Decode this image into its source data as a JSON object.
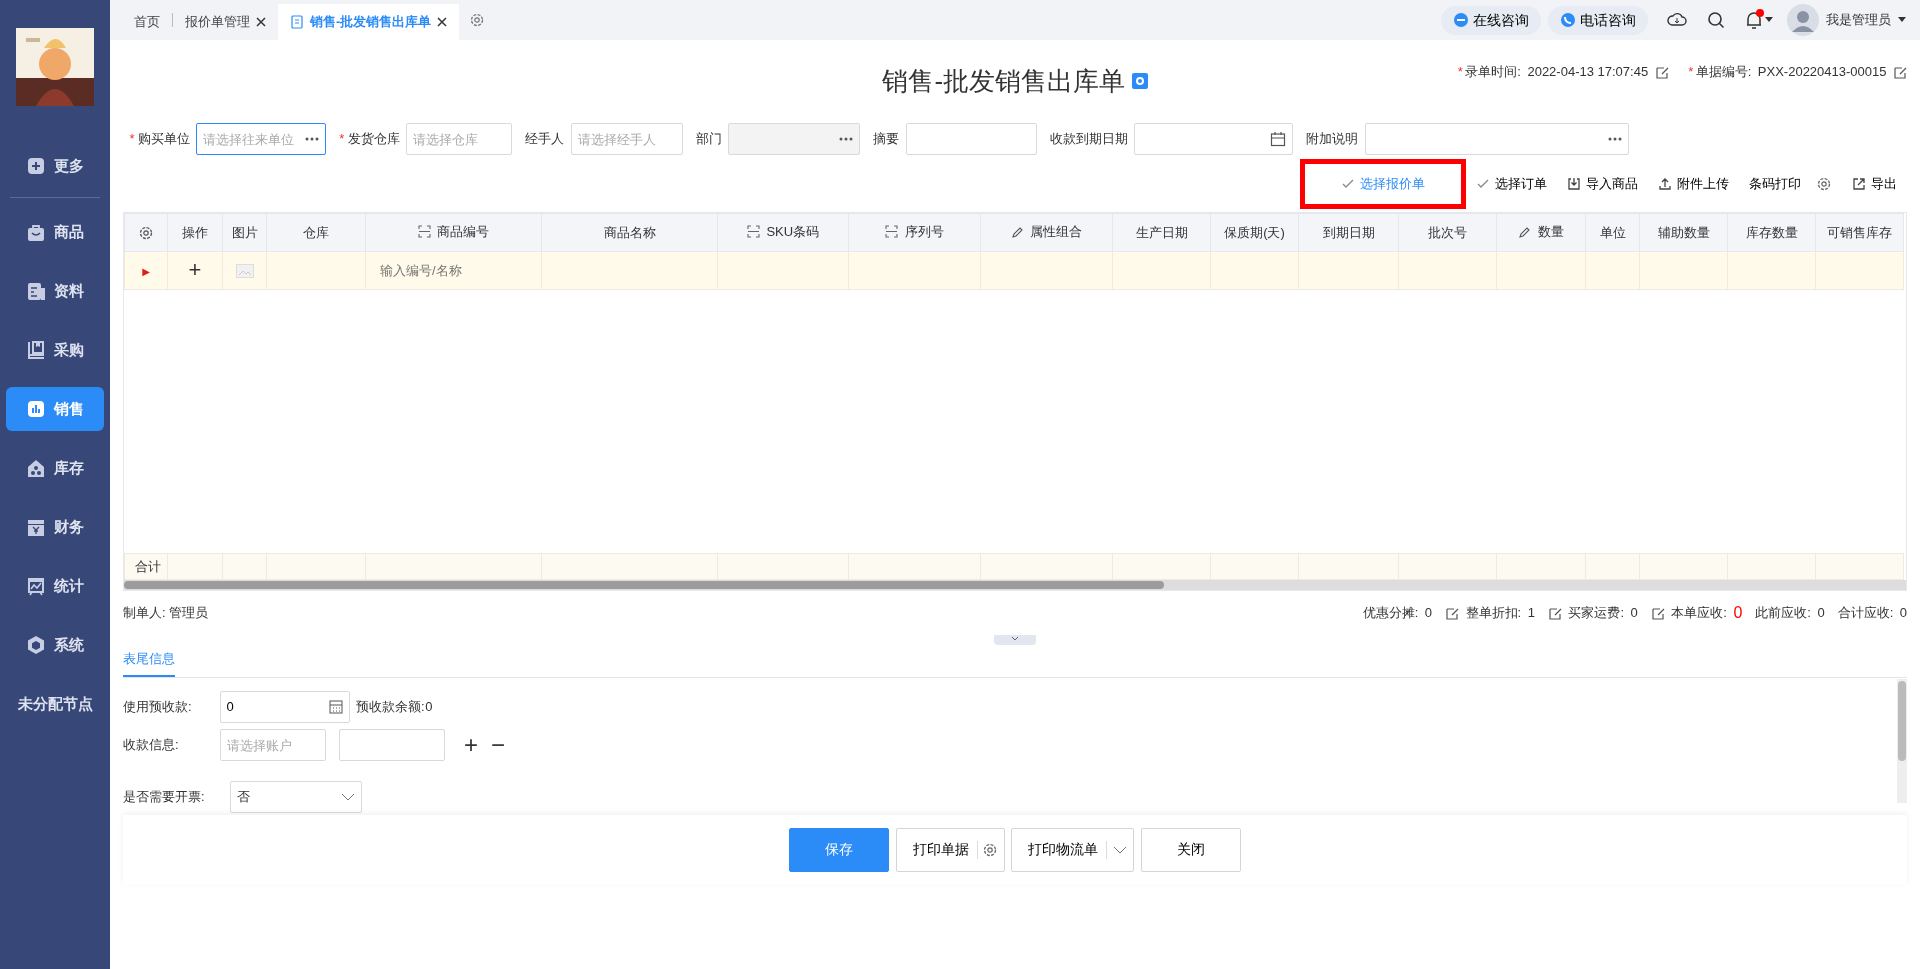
{
  "sidebar": {
    "items": [
      {
        "label": "更多",
        "selected": false
      },
      {
        "label": "商品",
        "selected": false
      },
      {
        "label": "资料",
        "selected": false
      },
      {
        "label": "采购",
        "selected": false
      },
      {
        "label": "销售",
        "selected": true
      },
      {
        "label": "库存",
        "selected": false
      },
      {
        "label": "财务",
        "selected": false
      },
      {
        "label": "统计",
        "selected": false
      },
      {
        "label": "系统",
        "selected": false
      },
      {
        "label": "未分配节点",
        "selected": false
      }
    ]
  },
  "tabs": [
    {
      "label": "首页",
      "selected": false,
      "closable": false
    },
    {
      "label": "报价单管理",
      "selected": false,
      "closable": true
    },
    {
      "label": "销售-批发销售出库单",
      "selected": true,
      "closable": true
    }
  ],
  "top_right": {
    "consult_buttons": [
      "在线咨询",
      "电话咨询"
    ],
    "notification_dot": true,
    "user": "我是管理员"
  },
  "header": {
    "title": "销售-批发销售出库单",
    "meta": [
      {
        "required_mark": "*",
        "label": "录单时间:",
        "value": "2022-04-13 17:07:45"
      },
      {
        "required_mark": "*",
        "label": "单据编号:",
        "value": "PXX-20220413-00015"
      }
    ]
  },
  "form_fields": [
    {
      "required_mark": "*",
      "label": "购买单位",
      "placeholder": "请选择往来单位",
      "kind": "dots",
      "focused": true,
      "disabled": false
    },
    {
      "required_mark": "*",
      "label": "发货仓库",
      "placeholder": "请选择仓库",
      "kind": "plain",
      "focused": false,
      "disabled": false
    },
    {
      "label": "经手人",
      "placeholder": "请选择经手人",
      "kind": "plain",
      "focused": false,
      "disabled": false
    },
    {
      "label": "部门",
      "kind": "dots",
      "focused": false,
      "disabled": true
    },
    {
      "label": "摘要",
      "kind": "plain",
      "focused": false,
      "disabled": false
    },
    {
      "label": "收款到期日期",
      "kind": "calendar",
      "focused": false,
      "disabled": false
    },
    {
      "label": "附加说明",
      "kind": "dots",
      "focused": false,
      "disabled": false
    }
  ],
  "toolbar": [
    {
      "label": "选择报价单",
      "kind": "check",
      "highlighted": true
    },
    {
      "label": "选择订单",
      "kind": "check",
      "highlighted": false
    },
    {
      "label": "导入商品",
      "kind": "import",
      "highlighted": false
    },
    {
      "label": "附件上传",
      "kind": "upload",
      "highlighted": false
    },
    {
      "label": "条码打印",
      "kind": "gear",
      "highlighted": false
    },
    {
      "label": "导出",
      "kind": "export",
      "highlighted": false
    }
  ],
  "table": {
    "columns": [
      {
        "kind": "settings"
      },
      {
        "label": "操作",
        "kind": "plain"
      },
      {
        "label": "图片",
        "kind": "plain"
      },
      {
        "label": "仓库",
        "kind": "plain"
      },
      {
        "label": "商品编号",
        "kind": "scan"
      },
      {
        "label": "商品名称",
        "kind": "plain"
      },
      {
        "label": "SKU条码",
        "kind": "scan"
      },
      {
        "label": "序列号",
        "kind": "scan"
      },
      {
        "label": "属性组合",
        "kind": "edit"
      },
      {
        "label": "生产日期",
        "kind": "plain"
      },
      {
        "label": "保质期(天)",
        "kind": "plain"
      },
      {
        "label": "到期日期",
        "kind": "plain"
      },
      {
        "label": "批次号",
        "kind": "plain"
      },
      {
        "label": "数量",
        "kind": "edit"
      },
      {
        "label": "单位",
        "kind": "plain"
      },
      {
        "label": "辅助数量",
        "kind": "plain"
      },
      {
        "label": "库存数量",
        "kind": "plain"
      },
      {
        "label": "可销售库存",
        "kind": "plain"
      }
    ],
    "rows": [
      {
        "marker": "▶",
        "add": "+",
        "product_placeholder": "输入编号/名称"
      }
    ],
    "total_label": "合计"
  },
  "maker": {
    "label": "制单人:",
    "value": "管理员"
  },
  "summary": [
    {
      "label": "优惠分摊:",
      "value": "0",
      "editable": false,
      "alert": false
    },
    {
      "label": "整单折扣:",
      "value": "1",
      "editable": true,
      "alert": false
    },
    {
      "label": "买家运费:",
      "value": "0",
      "editable": true,
      "alert": false
    },
    {
      "label": "本单应收:",
      "value": "0",
      "editable": true,
      "alert": true
    },
    {
      "label": "此前应收:",
      "value": "0",
      "editable": false,
      "alert": false
    },
    {
      "label": "合计应收:",
      "value": "0",
      "editable": false,
      "alert": false
    }
  ],
  "footer_tabs": [
    {
      "label": "表尾信息",
      "selected": true
    }
  ],
  "footer": {
    "prepay": {
      "label": "使用预收款:",
      "value": "0",
      "balance_label": "预收款余额:",
      "balance": "0"
    },
    "payment": {
      "label": "收款信息:",
      "account_placeholder": "请选择账户",
      "add": "+",
      "remove": "−"
    },
    "invoice": {
      "label": "是否需要开票:",
      "value": "否"
    }
  },
  "actions": [
    {
      "label": "保存",
      "kind": "primary"
    },
    {
      "label": "打印单据",
      "kind": "gear"
    },
    {
      "label": "打印物流单",
      "kind": "caret"
    },
    {
      "label": "关闭",
      "kind": "plain"
    }
  ]
}
